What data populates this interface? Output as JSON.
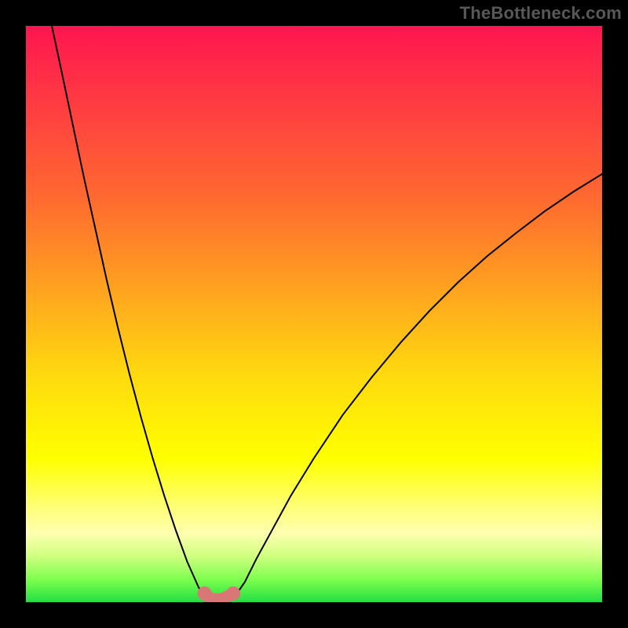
{
  "watermark": "TheBottleneck.com",
  "chart_data": {
    "type": "line",
    "title": "",
    "xlabel": "",
    "ylabel": "",
    "xlim": [
      0,
      100
    ],
    "ylim": [
      0,
      100
    ],
    "series": [
      {
        "name": "left-curve",
        "x": [
          4.5,
          6,
          8,
          10,
          12,
          14,
          16,
          18,
          20,
          22,
          24,
          26,
          28,
          30,
          31.5
        ],
        "values": [
          100,
          93,
          83.5,
          74,
          65,
          56,
          47.5,
          39.5,
          32,
          25,
          18.5,
          12.5,
          7,
          2.5,
          0.6
        ]
      },
      {
        "name": "right-curve",
        "x": [
          36,
          38,
          40,
          43,
          46,
          50,
          55,
          60,
          65,
          70,
          75,
          80,
          85,
          90,
          95,
          100
        ],
        "values": [
          0.6,
          3.5,
          7.5,
          13,
          18.5,
          25,
          32.5,
          39,
          45,
          50.5,
          55.5,
          60,
          64,
          67.8,
          71.2,
          74.3
        ]
      },
      {
        "name": "trough-highlight",
        "x": [
          31,
          32,
          33,
          34,
          36
        ],
        "values": [
          1.5,
          0.6,
          0.5,
          0.5,
          1.5
        ]
      }
    ],
    "background_gradient": {
      "top": "#ff1550",
      "mid": "#ffff00",
      "bottom": "#20e040"
    }
  }
}
